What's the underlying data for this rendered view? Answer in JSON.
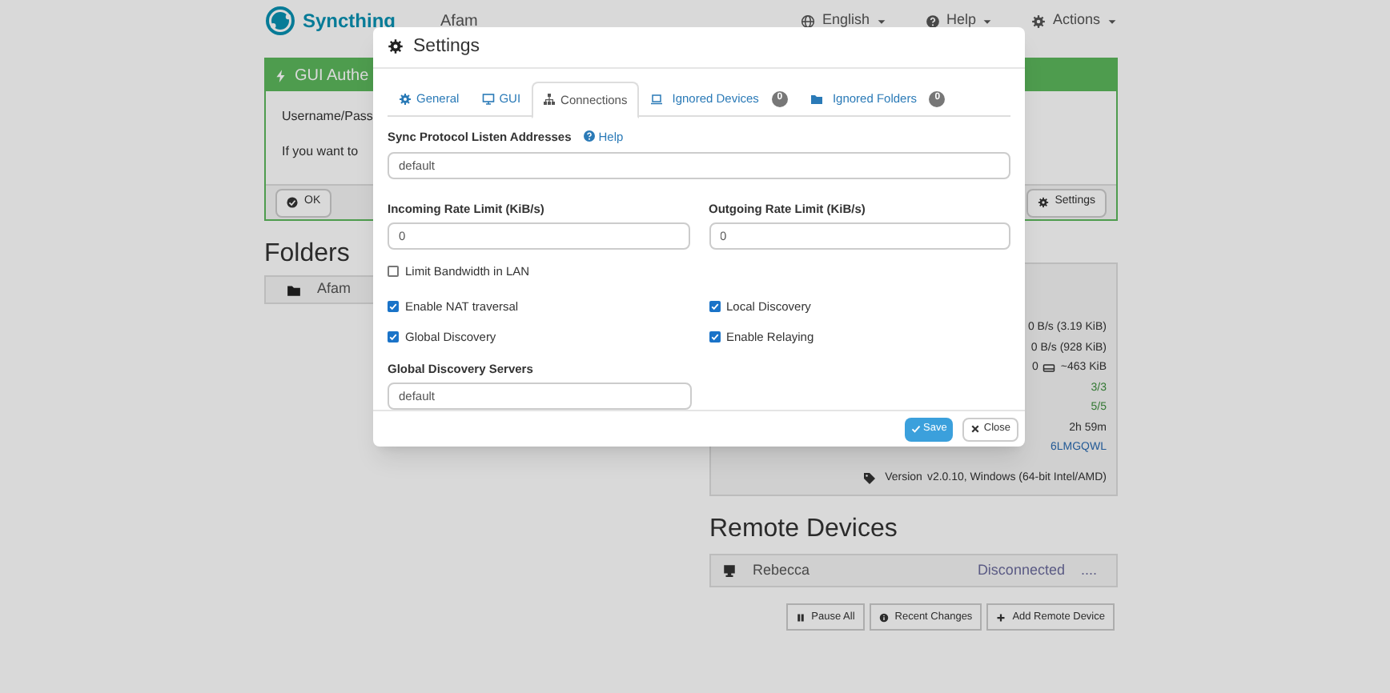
{
  "navbar": {
    "brand": "Syncthing",
    "device_name": "Afam",
    "menus": [
      {
        "label": "English"
      },
      {
        "label": "Help"
      },
      {
        "label": "Actions"
      }
    ]
  },
  "notice": {
    "title": "GUI Authe",
    "lines": [
      "Username/Pass",
      "If you want to"
    ],
    "buttons": [
      "OK",
      "Settings"
    ]
  },
  "folders": {
    "heading": "Folders",
    "items": [
      {
        "name": "Afam"
      }
    ]
  },
  "this_device": {
    "rows": [
      {
        "kind": "plain",
        "value": "0 B/s (3.19 KiB)"
      },
      {
        "kind": "plain",
        "value": "0 B/s (928 KiB)"
      },
      {
        "kind": "disk",
        "prefix": "0",
        "value": "~463 KiB"
      },
      {
        "kind": "good",
        "value": "3/3"
      },
      {
        "kind": "good",
        "value": "5/5"
      },
      {
        "kind": "plain",
        "value": "2h 59m"
      },
      {
        "kind": "link",
        "value": "6LMGQWL"
      },
      {
        "kind": "labeled",
        "label": "Version",
        "value": "v2.0.10, Windows (64-bit Intel/AMD)"
      }
    ]
  },
  "remote_devices": {
    "heading": "Remote Devices",
    "items": [
      {
        "name": "Rebecca",
        "status": "Disconnected",
        "extra": "...."
      }
    ],
    "buttons": [
      "Pause All",
      "Recent Changes",
      "Add Remote Device"
    ]
  },
  "modal": {
    "title": "Settings",
    "tabs": [
      {
        "label": "General",
        "selected": false
      },
      {
        "label": "GUI",
        "selected": false
      },
      {
        "label": "Connections",
        "selected": true
      },
      {
        "label": "Ignored Devices",
        "selected": false,
        "count": "0"
      },
      {
        "label": "Ignored Folders",
        "selected": false,
        "count": "0"
      }
    ],
    "listen": {
      "label": "Sync Protocol Listen Addresses",
      "help": "Help",
      "value": "default"
    },
    "rate_limits": [
      {
        "label": "Incoming Rate Limit (KiB/s)",
        "value": "0"
      },
      {
        "label": "Outgoing Rate Limit (KiB/s)",
        "value": "0"
      }
    ],
    "option_rows": [
      [
        {
          "label": "Limit Bandwidth in LAN",
          "checked": false
        }
      ],
      [
        {
          "label": "Enable NAT traversal",
          "checked": true
        },
        {
          "label": "Local Discovery",
          "checked": true
        }
      ],
      [
        {
          "label": "Global Discovery",
          "checked": true
        },
        {
          "label": "Enable Relaying",
          "checked": true
        }
      ]
    ],
    "discovery_servers": {
      "label": "Global Discovery Servers",
      "value": "default"
    },
    "buttons": [
      {
        "label": "Save",
        "kind": "primary"
      },
      {
        "label": "Close",
        "kind": "default"
      }
    ]
  }
}
